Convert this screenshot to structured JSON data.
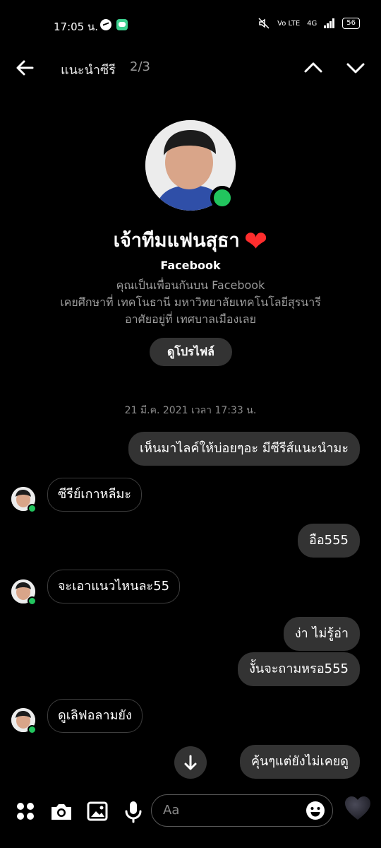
{
  "status_bar": {
    "time": "17:05 น.",
    "network": "Vo LTE",
    "signal": "4G",
    "battery": "56"
  },
  "header": {
    "title": "แนะนำซีรี",
    "match_count": "2/3"
  },
  "profile": {
    "name": "เจ้าทีมแฟนสุธา",
    "platform": "Facebook",
    "line1": "คุณเป็นเพื่อนกันบน Facebook",
    "line2": "เคยศึกษาที่ เทคโนธานี มหาวิทยาลัยเทคโนโลยีสุรนารี",
    "line3": "อาศัยอยู่ที่ เทศบาลเมืองเลย",
    "view_profile_label": "ดูโปรไฟล์"
  },
  "conversation": {
    "timestamp": "21 มี.ค. 2021 เวลา 17:33 น.",
    "messages": [
      {
        "from": "me",
        "text": "เห็นมาไลค์ให้บ่อยๆอะ มีซีรีส์แนะนำมะ"
      },
      {
        "from": "them",
        "text": "ซีรีย์เกาหลีมะ"
      },
      {
        "from": "me",
        "text": "อือ555"
      },
      {
        "from": "them",
        "text": "จะเอาแนวไหนละ55"
      },
      {
        "from": "me",
        "text": "ง่า ไม่รู้อ่า"
      },
      {
        "from": "me",
        "text": "งั้นจะถามหรอ555"
      },
      {
        "from": "them",
        "text": "ดูเลิฟอลามยัง"
      },
      {
        "from": "me",
        "text": "คุ้นๆแต่ยังไม่เคยดู"
      }
    ]
  },
  "composer": {
    "placeholder": "Aa"
  },
  "colors": {
    "background": "#000000",
    "bubble_out": "#333333",
    "bubble_in_border": "#3d3d3d",
    "online": "#22c55e",
    "heart": "#ff2d2d"
  }
}
